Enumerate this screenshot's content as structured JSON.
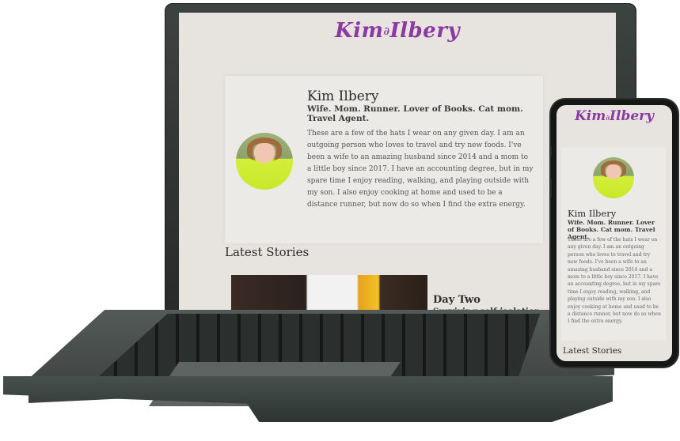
{
  "site": {
    "logo_text": "Kim",
    "logo_text_2": "Ilbery",
    "logo_swirl": "∂",
    "brand_color": "#8a3aa0"
  },
  "hero": {
    "name": "Kim Ilbery",
    "tagline": "Wife. Mom. Runner. Lover of Books. Cat mom. Travel Agent.",
    "bio": "These are a few of the hats I wear on any given day. I am an outgoing person who loves to travel and try new foods. I've been a wife to an amazing husband since 2014 and a mom to a little boy since 2017. I have an accounting degree, but in my spare time I enjoy reading, walking, and playing outside with my son. I also enjoy cooking at home and used to be a distance runner, but now do so when I find the extra energy."
  },
  "stories": {
    "section_title": "Latest Stories",
    "items": [
      {
        "title": "Day Two",
        "subtitle": "Surviving self isolation."
      }
    ]
  }
}
